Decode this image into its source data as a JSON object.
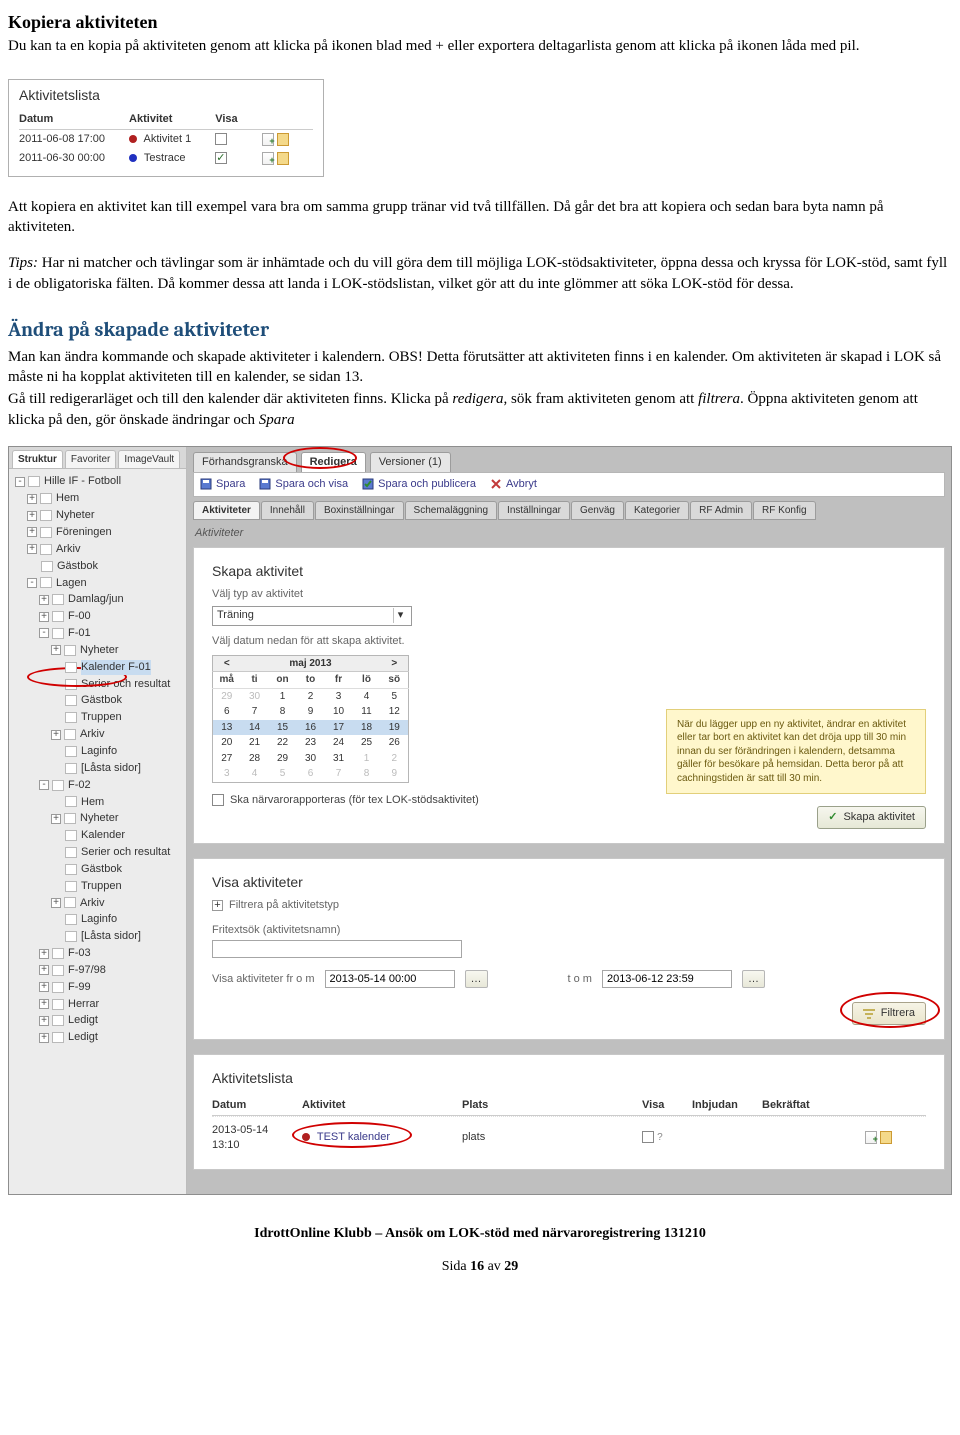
{
  "doc": {
    "h1": "Kopiera aktiviteten",
    "p1": "Du kan ta en kopia på aktiviteten genom att klicka på ikonen blad med + eller exportera deltagarlista genom att klicka på ikonen låda med pil.",
    "p2": "Att kopiera en aktivitet kan till exempel vara bra om samma grupp tränar vid två tillfällen. Då går det bra att kopiera och sedan bara byta namn på aktiviteten.",
    "tips_label": "Tips:",
    "tips_body": " Har ni matcher och tävlingar som är inhämtade och du vill göra dem till möjliga LOK-stödsaktiviteter, öppna dessa och kryssa för LOK-stöd, samt fyll i de obligatoriska fälten. Då kommer dessa att landa i LOK-stödslistan, vilket gör att du inte glömmer att söka LOK-stöd för dessa.",
    "h2": "Ändra på skapade aktiviteter",
    "p3a": "Man kan ändra kommande och skapade aktiviteter i kalendern. OBS! Detta förutsätter att aktiviteten finns i en kalender. Om aktiviteten är skapad i LOK så måste ni ha kopplat aktiviteten till en kalender, se sidan 13.",
    "p3b": "Gå till redigerarläget och till den kalender där aktiviteten finns. Klicka på ",
    "p3b_em1": "redigera",
    "p3b_mid": ", sök fram aktiviteten genom att ",
    "p3b_em2": "filtrera",
    "p3b_end": ". Öppna aktiviteten genom att klicka på den, gör önskade ändringar och ",
    "p3b_em3": "Spara"
  },
  "shot1": {
    "title": "Aktivitetslista",
    "cols": {
      "c1": "Datum",
      "c2": "Aktivitet",
      "c3": "Visa"
    },
    "rows": [
      {
        "date": "2011-06-08 17:00",
        "bullet": "red",
        "name": "Aktivitet 1",
        "checked": false
      },
      {
        "date": "2011-06-30 00:00",
        "bullet": "blue",
        "name": "Testrace",
        "checked": true
      }
    ]
  },
  "app": {
    "sidebar_tabs": {
      "t1": "Struktur",
      "t2": "Favoriter",
      "t3": "ImageVault"
    },
    "tree": [
      {
        "lvl": 0,
        "exp": "-",
        "label": "Hille IF - Fotboll"
      },
      {
        "lvl": 1,
        "exp": "+",
        "label": "Hem"
      },
      {
        "lvl": 1,
        "exp": "+",
        "label": "Nyheter"
      },
      {
        "lvl": 1,
        "exp": "+",
        "label": "Föreningen"
      },
      {
        "lvl": 1,
        "exp": "+",
        "label": "Arkiv"
      },
      {
        "lvl": 1,
        "exp": "",
        "label": "Gästbok"
      },
      {
        "lvl": 1,
        "exp": "-",
        "label": "Lagen"
      },
      {
        "lvl": 2,
        "exp": "+",
        "label": "Damlag/jun"
      },
      {
        "lvl": 2,
        "exp": "+",
        "label": "F-00"
      },
      {
        "lvl": 2,
        "exp": "-",
        "label": "F-01"
      },
      {
        "lvl": 3,
        "exp": "+",
        "label": "Nyheter"
      },
      {
        "lvl": 3,
        "exp": "",
        "label": "Kalender F-01",
        "hl": true
      },
      {
        "lvl": 3,
        "exp": "",
        "label": "Serier och resultat"
      },
      {
        "lvl": 3,
        "exp": "",
        "label": "Gästbok"
      },
      {
        "lvl": 3,
        "exp": "",
        "label": "Truppen"
      },
      {
        "lvl": 3,
        "exp": "+",
        "label": "Arkiv"
      },
      {
        "lvl": 3,
        "exp": "",
        "label": "Laginfo"
      },
      {
        "lvl": 3,
        "exp": "",
        "label": "[Låsta sidor]"
      },
      {
        "lvl": 2,
        "exp": "-",
        "label": "F-02"
      },
      {
        "lvl": 3,
        "exp": "",
        "label": "Hem"
      },
      {
        "lvl": 3,
        "exp": "+",
        "label": "Nyheter"
      },
      {
        "lvl": 3,
        "exp": "",
        "label": "Kalender"
      },
      {
        "lvl": 3,
        "exp": "",
        "label": "Serier och resultat"
      },
      {
        "lvl": 3,
        "exp": "",
        "label": "Gästbok"
      },
      {
        "lvl": 3,
        "exp": "",
        "label": "Truppen"
      },
      {
        "lvl": 3,
        "exp": "+",
        "label": "Arkiv"
      },
      {
        "lvl": 3,
        "exp": "",
        "label": "Laginfo"
      },
      {
        "lvl": 3,
        "exp": "",
        "label": "[Låsta sidor]"
      },
      {
        "lvl": 2,
        "exp": "+",
        "label": "F-03"
      },
      {
        "lvl": 2,
        "exp": "+",
        "label": "F-97/98"
      },
      {
        "lvl": 2,
        "exp": "+",
        "label": "F-99"
      },
      {
        "lvl": 2,
        "exp": "+",
        "label": "Herrar"
      },
      {
        "lvl": 2,
        "exp": "+",
        "label": "Ledigt"
      },
      {
        "lvl": 2,
        "exp": "+",
        "label": "Ledigt"
      }
    ],
    "mode_tabs": {
      "t1": "Förhandsgranska",
      "t2": "Redigera",
      "t3": "Versioner (1)"
    },
    "actions": {
      "a1": "Spara",
      "a2": "Spara och visa",
      "a3": "Spara och publicera",
      "a4": "Avbryt"
    },
    "sub_tabs": [
      "Aktiviteter",
      "Innehåll",
      "Boxinställningar",
      "Schemaläggning",
      "Inställningar",
      "Genväg",
      "Kategorier",
      "RF Admin",
      "RF Konfig"
    ],
    "section_label": "Aktiviteter",
    "panel1": {
      "title": "Skapa aktivitet",
      "sub": "Välj typ av aktivitet",
      "select_value": "Träning",
      "date_text": "Välj datum nedan för att skapa aktivitet.",
      "month": "maj 2013",
      "checkbox_label": "Ska närvarorapporteras (för tex LOK-stödsaktivitet)",
      "tip": "När du lägger upp en ny aktivitet, ändrar en aktivitet eller tar bort en aktivitet kan det dröja upp till 30 min innan du ser förändringen i kalendern, detsamma gäller för besökare på hemsidan. Detta beror på att cachningstiden är satt till 30 min.",
      "create_btn": "Skapa aktivitet"
    },
    "cal": {
      "days": [
        "må",
        "ti",
        "on",
        "to",
        "fr",
        "lö",
        "sö"
      ],
      "rows": [
        [
          "29",
          "30",
          "1",
          "2",
          "3",
          "4",
          "5"
        ],
        [
          "6",
          "7",
          "8",
          "9",
          "10",
          "11",
          "12"
        ],
        [
          "13",
          "14",
          "15",
          "16",
          "17",
          "18",
          "19"
        ],
        [
          "20",
          "21",
          "22",
          "23",
          "24",
          "25",
          "26"
        ],
        [
          "27",
          "28",
          "29",
          "30",
          "31",
          "1",
          "2"
        ],
        [
          "3",
          "4",
          "5",
          "6",
          "7",
          "8",
          "9"
        ]
      ],
      "dim_first": 2,
      "dim_last_row5": 2,
      "sel_row": 2
    },
    "panel2": {
      "title": "Visa aktiviteter",
      "filter_type": "Filtrera på aktivitetstyp",
      "search_label": "Fritextsök (aktivitetsnamn)",
      "from_label": "Visa aktiviteter fr o m",
      "from_value": "2013-05-14 00:00",
      "to_label": "t o m",
      "to_value": "2013-06-12 23:59",
      "filter_btn": "Filtrera"
    },
    "panel3": {
      "title": "Aktivitetslista",
      "cols": {
        "c1": "Datum",
        "c2": "Aktivitet",
        "c3": "Plats",
        "c4": "Visa",
        "c5": "Inbjudan",
        "c6": "Bekräftat"
      },
      "row": {
        "date1": "2013-05-14",
        "date2": "13:10",
        "name": "TEST kalender",
        "place": "plats"
      }
    }
  },
  "footer": {
    "line1": "IdrottOnline Klubb – Ansök om LOK-stöd med närvaroregistrering 131210",
    "line2a": "Sida ",
    "line2b": "16",
    "line2c": " av ",
    "line2d": "29"
  }
}
